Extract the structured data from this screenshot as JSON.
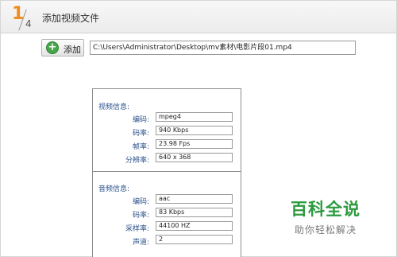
{
  "step": {
    "current": "1",
    "total": "4"
  },
  "header": {
    "title": "添加视频文件"
  },
  "toolbar": {
    "add_label": "添加",
    "path_value": "C:\\Users\\Administrator\\Desktop\\mv素材\\电影片段01.mp4"
  },
  "video": {
    "title": "视频信息:",
    "fields": [
      {
        "label": "编码:",
        "value": "mpeg4"
      },
      {
        "label": "码率:",
        "value": "940 Kbps"
      },
      {
        "label": "帧率:",
        "value": "23.98 Fps"
      },
      {
        "label": "分辨率:",
        "value": "640 x 368"
      }
    ]
  },
  "audio": {
    "title": "音频信息:",
    "fields": [
      {
        "label": "编码:",
        "value": "aac"
      },
      {
        "label": "码率:",
        "value": "83 Kbps"
      },
      {
        "label": "采样率:",
        "value": "44100 HZ"
      },
      {
        "label": "声道:",
        "value": "2"
      }
    ]
  },
  "watermark": {
    "title": "百科全说",
    "subtitle": "助你轻松解决"
  },
  "colors": {
    "accent": "#f08c1e",
    "label": "#2a4f8a",
    "watermark": "#2b9a3e",
    "add_icon": "#46a84a"
  },
  "icons": {
    "add": "plus-circle-icon"
  }
}
